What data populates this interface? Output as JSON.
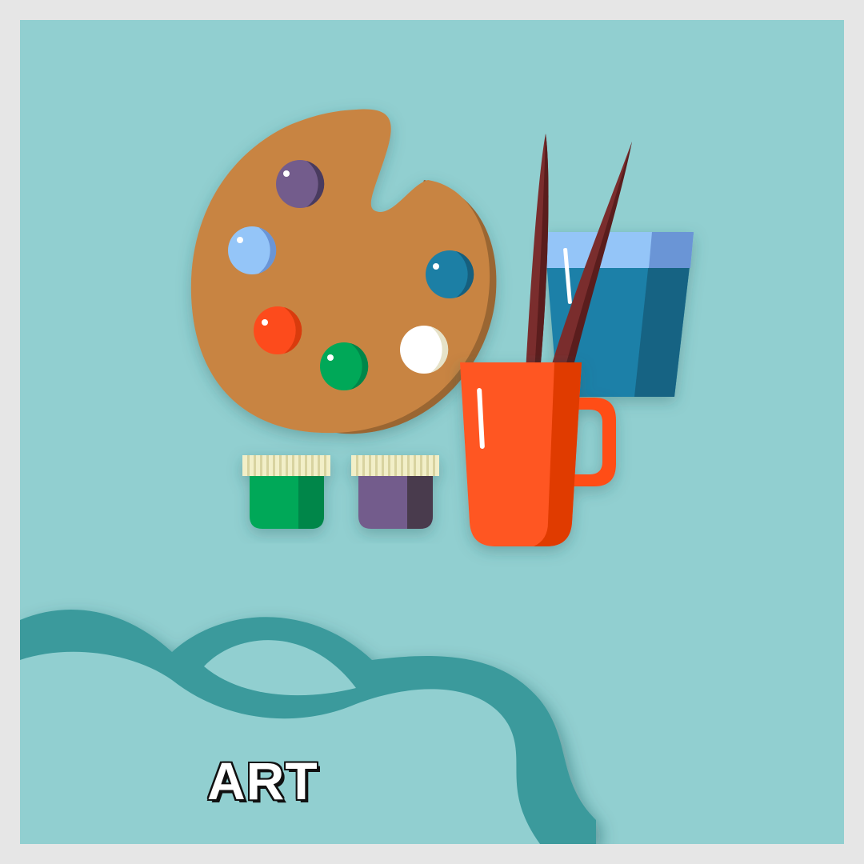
{
  "title": {
    "text": "ART"
  },
  "colors": {
    "frame": "#e6e6e6",
    "background": "#91cfd0",
    "wave_dark": "#3a9a9c",
    "palette_wood": "#c88443",
    "palette_wood_shadow": "#9a6633",
    "paint_purple": "#735c8c",
    "paint_light_blue": "#94c5f8",
    "paint_teal_blue": "#1c7fa5",
    "paint_red_orange": "#fd4c1f",
    "paint_green": "#00a859",
    "paint_white": "#ffffff",
    "water_glass": "#1e80a8",
    "mug": "#ff5722",
    "brush_handle": "#7a2d2d"
  },
  "icons": [
    "palette-icon",
    "paint-jar-icon",
    "water-glass-icon",
    "mug-icon",
    "paintbrush-icon"
  ]
}
